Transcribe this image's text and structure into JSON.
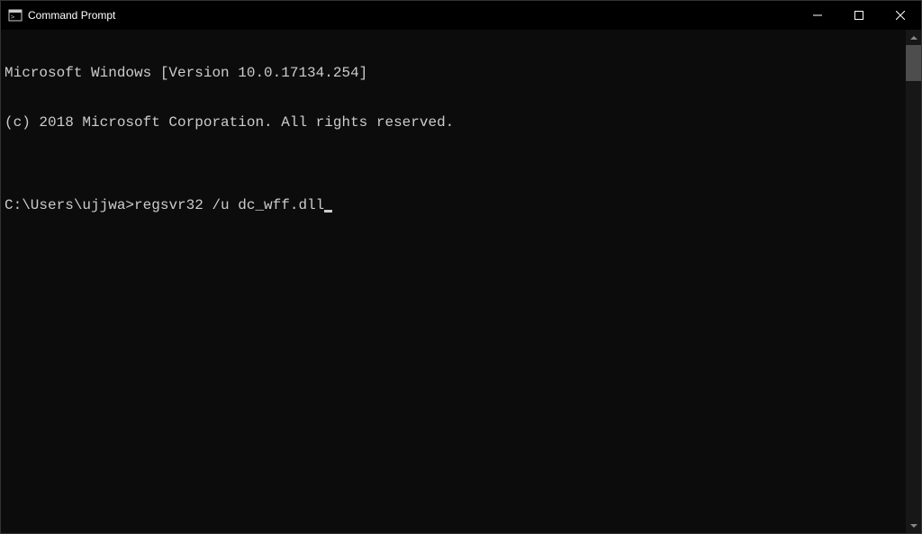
{
  "window": {
    "title": "Command Prompt"
  },
  "terminal": {
    "line1": "Microsoft Windows [Version 10.0.17134.254]",
    "line2": "(c) 2018 Microsoft Corporation. All rights reserved.",
    "blank": "",
    "prompt": "C:\\Users\\ujjwa>",
    "command": "regsvr32 /u dc_wff.dll"
  }
}
